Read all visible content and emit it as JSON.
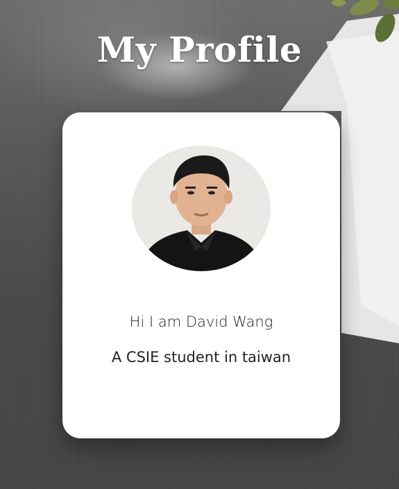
{
  "page": {
    "title": "My Profile"
  },
  "profile": {
    "avatar_icon": "profile-photo",
    "greeting": "Hi I am David Wang",
    "description": "A CSIE student in taiwan"
  },
  "colors": {
    "card_background": "#ffffff",
    "title_text": "#ffffff",
    "body_text": "#222222",
    "backdrop": "#4a4846"
  }
}
